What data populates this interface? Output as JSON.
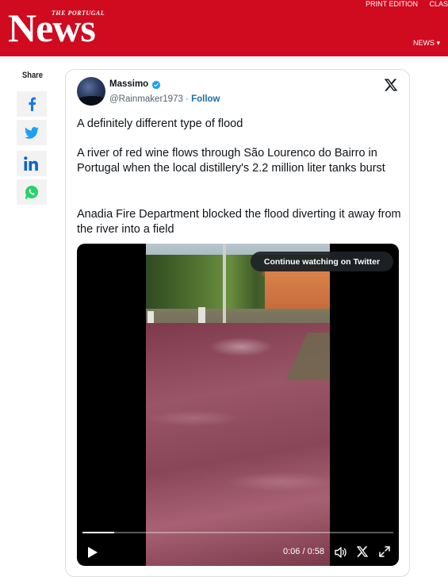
{
  "header": {
    "brand_small": "THE PORTUGAL",
    "brand_large": "News",
    "top_links": [
      "PRINT EDITION",
      "CLAS"
    ],
    "nav_news": "NEWS ▾",
    "color": "#d00a1f"
  },
  "share": {
    "label": "Share",
    "buttons": [
      {
        "name": "facebook-icon",
        "color": "#1877f2"
      },
      {
        "name": "twitter-icon",
        "color": "#1da1f2"
      },
      {
        "name": "linkedin-icon",
        "color": "#0a66c2"
      },
      {
        "name": "whatsapp-icon",
        "color": "#25d366"
      }
    ]
  },
  "tweet": {
    "author_name": "Massimo",
    "handle": "@Rainmaker1973",
    "separator": " · ",
    "follow_label": "Follow",
    "text_1": "A definitely different type of flood",
    "text_2": "A river of red wine flows through São Lourenco do Bairro in Portugal when the local distillery's 2.2 million liter tanks burst",
    "text_3": "Anadia Fire Department blocked the flood diverting it away from the river into a field",
    "video": {
      "continue_label": "Continue watching on Twitter",
      "time": "0:06 / 0:58",
      "progress_fraction": 0.103
    }
  }
}
